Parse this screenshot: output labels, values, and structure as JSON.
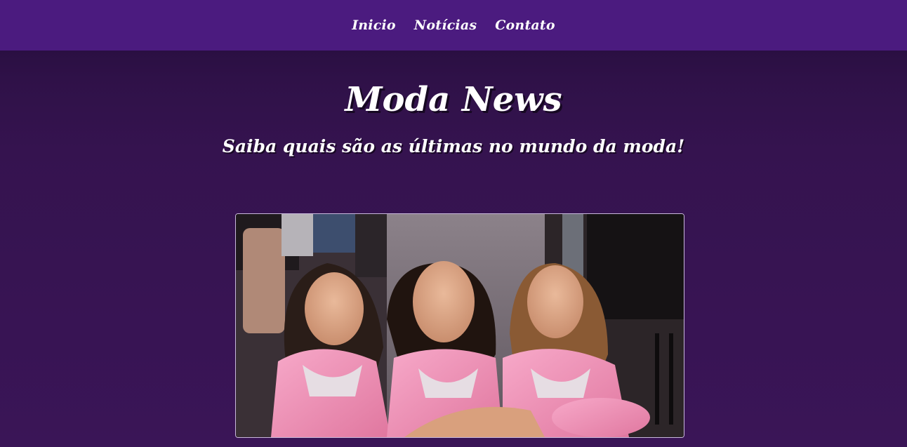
{
  "nav": {
    "items": [
      {
        "label": "Inicio"
      },
      {
        "label": "Notícias"
      },
      {
        "label": "Contato"
      }
    ]
  },
  "hero": {
    "title": "Moda News",
    "subtitle": "Saiba quais são as últimas no mundo da moda!"
  },
  "colors": {
    "nav_bg": "#4b1b7f",
    "page_bg": "#36124f",
    "text": "#ffffff",
    "robe_pink": "#f08fb7"
  }
}
